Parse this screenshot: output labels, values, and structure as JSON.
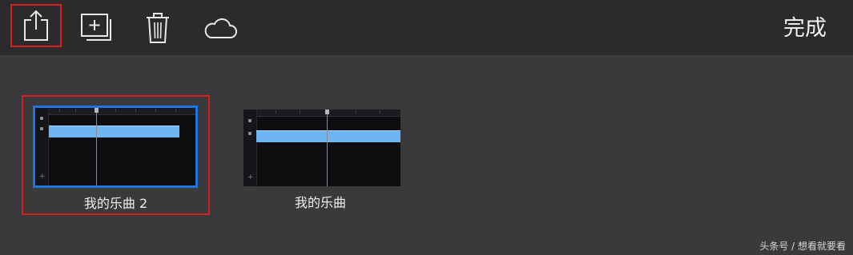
{
  "toolbar": {
    "share_icon": "share-icon",
    "duplicate_icon": "duplicate-icon",
    "delete_icon": "trash-icon",
    "cloud_icon": "cloud-icon",
    "done_label": "完成"
  },
  "projects": [
    {
      "name": "我的乐曲 2",
      "selected": true
    },
    {
      "name": "我的乐曲",
      "selected": false
    }
  ],
  "watermark": "头条号 / 想看就要看",
  "colors": {
    "toolbar_bg": "#2b2a2c",
    "page_bg": "#3a393b",
    "selection_red": "#d81e1e",
    "selection_blue": "#1d76e0",
    "track_blue": "#6fb5f2"
  }
}
